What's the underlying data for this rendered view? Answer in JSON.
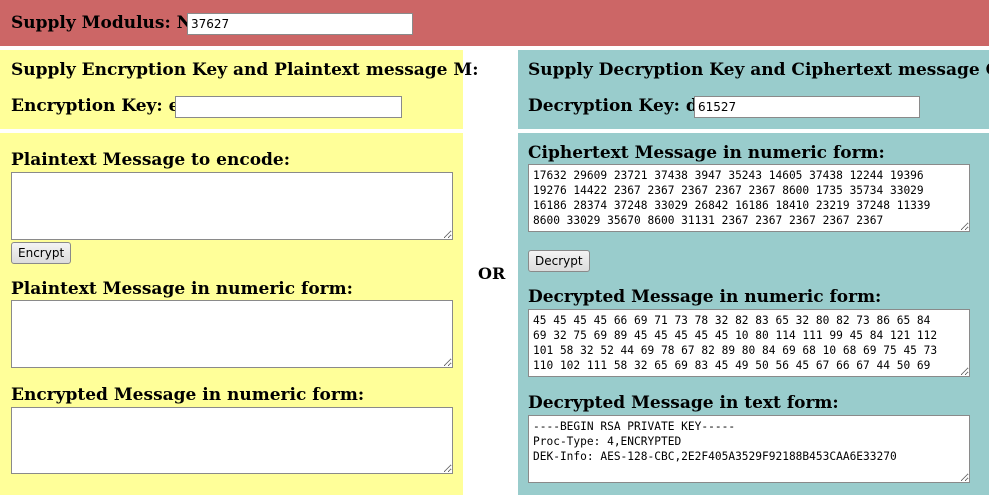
{
  "modulus": {
    "label": "Supply Modulus: N",
    "value": "37627"
  },
  "encrypt_side": {
    "header": "Supply Encryption Key and Plaintext message M:",
    "key_label": "Encryption Key: e",
    "key_value": "",
    "plaintext_label": "Plaintext Message to encode:",
    "plaintext_value": "",
    "encrypt_button": "Encrypt",
    "plain_numeric_label": "Plaintext Message in numeric form:",
    "plain_numeric_value": "",
    "encrypted_numeric_label": "Encrypted Message in numeric form:",
    "encrypted_numeric_value": ""
  },
  "separator": "OR",
  "decrypt_side": {
    "header": "Supply Decryption Key and Ciphertext message C:",
    "key_label": "Decryption Key: d",
    "key_value": "61527",
    "cipher_label": "Ciphertext Message in numeric form:",
    "cipher_value": "17632 29609 23721 37438 3947 35243 14605 37438 12244 19396\n19276 14422 2367 2367 2367 2367 2367 8600 1735 35734 33029\n16186 28374 37248 33029 26842 16186 18410 23219 37248 11339\n8600 33029 35670 8600 31131 2367 2367 2367 2367 2367",
    "decrypt_button": "Decrypt",
    "decrypted_numeric_label": "Decrypted Message in numeric form:",
    "decrypted_numeric_value": "45 45 45 45 66 69 71 73 78 32 82 83 65 32 80 82 73 86 65 84\n69 32 75 69 89 45 45 45 45 45 10 80 114 111 99 45 84 121 112\n101 58 32 52 44 69 78 67 82 89 80 84 69 68 10 68 69 75 45 73\n110 102 111 58 32 65 69 83 45 49 50 56 45 67 66 67 44 50 69",
    "decrypted_text_label": "Decrypted Message in text form:",
    "decrypted_text_value": "----BEGIN RSA PRIVATE KEY-----\nProc-Type: 4,ENCRYPTED\nDEK-Info: AES-128-CBC,2E2F405A3529F92188B453CAA6E33270"
  }
}
